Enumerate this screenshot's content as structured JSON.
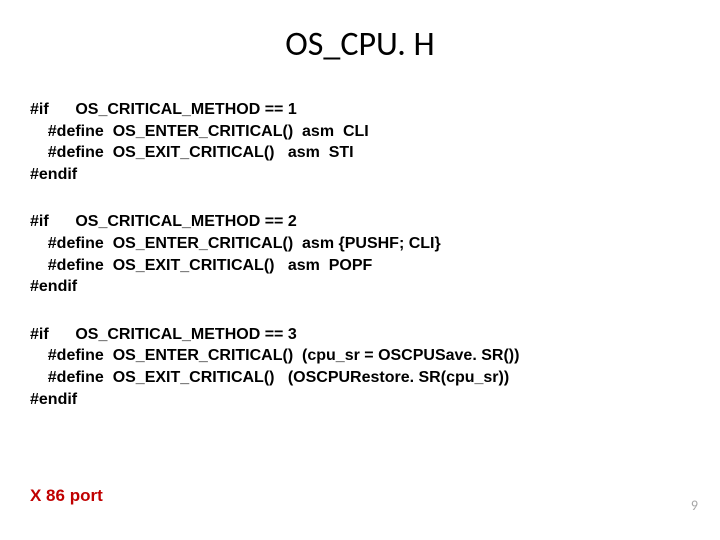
{
  "title": "OS_CPU. H",
  "blocks": [
    "#if      OS_CRITICAL_METHOD == 1\n    #define  OS_ENTER_CRITICAL()  asm  CLI\n    #define  OS_EXIT_CRITICAL()   asm  STI\n#endif",
    "#if      OS_CRITICAL_METHOD == 2\n    #define  OS_ENTER_CRITICAL()  asm {PUSHF; CLI}\n    #define  OS_EXIT_CRITICAL()   asm  POPF\n#endif",
    "#if      OS_CRITICAL_METHOD == 3\n    #define  OS_ENTER_CRITICAL()  (cpu_sr = OSCPUSave. SR())\n    #define  OS_EXIT_CRITICAL()   (OSCPURestore. SR(cpu_sr))\n#endif"
  ],
  "caption": "X 86 port",
  "page_number": "9"
}
